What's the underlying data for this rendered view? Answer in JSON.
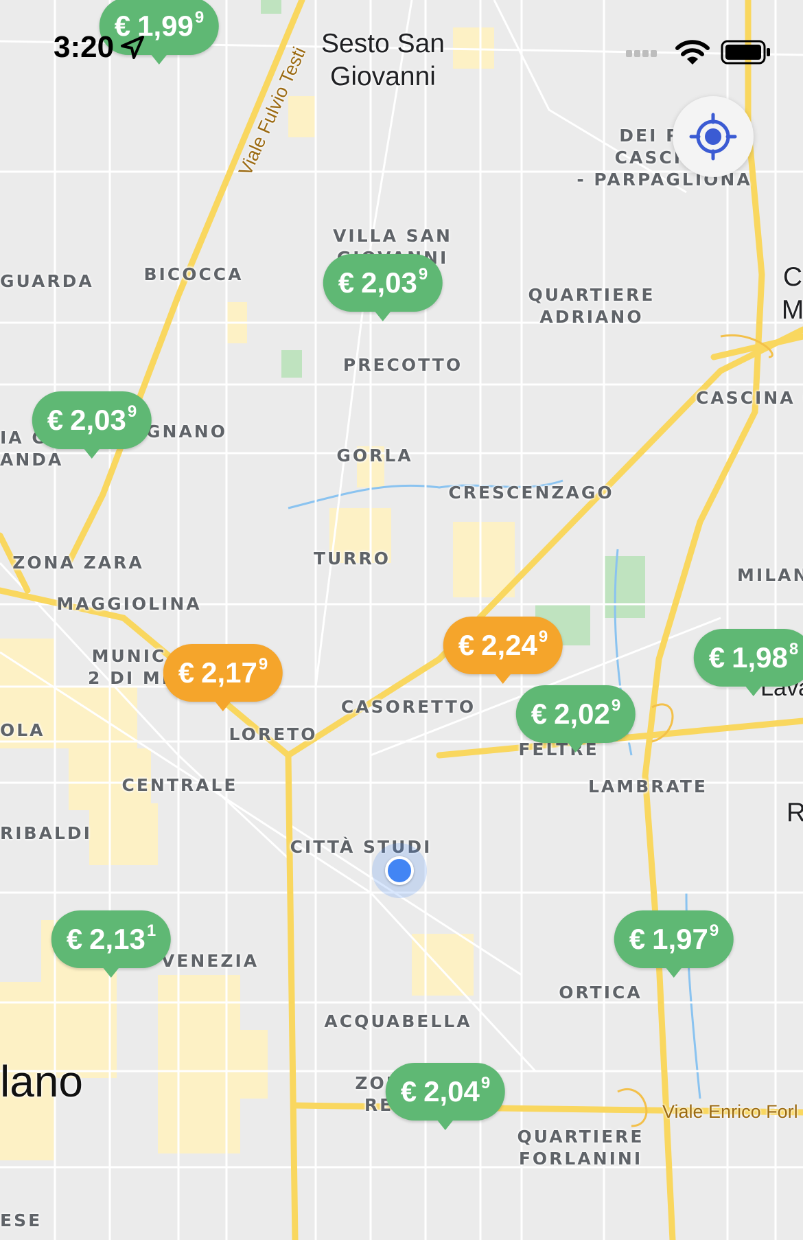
{
  "status_bar": {
    "time": "3:20",
    "location_icon": "location-arrow-icon",
    "signal_icon": "cellular-signal-icon",
    "wifi_icon": "wifi-icon",
    "battery_icon": "battery-icon"
  },
  "map": {
    "cities": {
      "sesto": "Sesto San\nGiovanni",
      "milano": "lano",
      "edge_c": "C\nM"
    },
    "roads": {
      "fulvio_testi": "Viale Fulvio Testi",
      "enrico_forlanini": "Viale Enrico Forl"
    },
    "districts": {
      "dei_parchi": "DEI PAR\nCASCINA\n- PARPAGLIONA",
      "villa_san_giovanni": "VILLA SAN\nGIOVANNI",
      "bicocca": "BICOCCA",
      "guarda": "GUARDA",
      "quartiere_adriano": "QUARTIERE\nADRIANO",
      "precotto": "PRECOTTO",
      "cascina": "CASCINA C",
      "gnano": "GNANO",
      "ia_c_anda": "IA C\nANDA",
      "gorla": "GORLA",
      "crescenzago": "CRESCENZAGO",
      "zona_zara": "ZONA ZARA",
      "turro": "TURRO",
      "milan": "MILAN",
      "maggiolina": "MAGGIOLINA",
      "municipio": "MUNIC\n2 DI MI",
      "casoretto": "CASORETTO",
      "ola": "OLA",
      "loreto": "LORETO",
      "feltre": "FELTRE",
      "centrale": "CENTRALE",
      "lambrate": "LAMBRATE",
      "ribaldi": "RIBALDI",
      "citta_studi": "CITTÀ STUDI",
      "venezia": "VENEZIA",
      "ortica": "ORTICA",
      "acquabella": "ACQUABELLA",
      "zona_re": "ZON\nRE",
      "quartiere_forlanini": "QUARTIERE\nFORLANINI",
      "ese": "ESE",
      "lava": "Lava",
      "edge_r": "R"
    }
  },
  "price_pins": [
    {
      "id": "p1",
      "currency": "€",
      "price": "1,99",
      "decimal": "9",
      "status": "green"
    },
    {
      "id": "p2",
      "currency": "€",
      "price": "2,03",
      "decimal": "9",
      "status": "green"
    },
    {
      "id": "p3",
      "currency": "€",
      "price": "2,03",
      "decimal": "9",
      "status": "green"
    },
    {
      "id": "p4",
      "currency": "€",
      "price": "2,24",
      "decimal": "9",
      "status": "orange"
    },
    {
      "id": "p5",
      "currency": "€",
      "price": "2,17",
      "decimal": "9",
      "status": "orange"
    },
    {
      "id": "p6",
      "currency": "€",
      "price": "1,98",
      "decimal": "8",
      "status": "green"
    },
    {
      "id": "p7",
      "currency": "€",
      "price": "2,02",
      "decimal": "9",
      "status": "green"
    },
    {
      "id": "p8",
      "currency": "€",
      "price": "2,13",
      "decimal": "1",
      "status": "green"
    },
    {
      "id": "p9",
      "currency": "€",
      "price": "1,97",
      "decimal": "9",
      "status": "green"
    },
    {
      "id": "p10",
      "currency": "€",
      "price": "2,04",
      "decimal": "9",
      "status": "green"
    }
  ],
  "colors": {
    "green": "#5fb874",
    "orange": "#f5a52b",
    "highway": "#f9d75f",
    "urban": "#fdf1c5",
    "water": "#8ac3f0",
    "park": "#bfe3bf",
    "accent": "#3b5bd3"
  },
  "controls": {
    "locate_icon": "target-location-icon"
  }
}
